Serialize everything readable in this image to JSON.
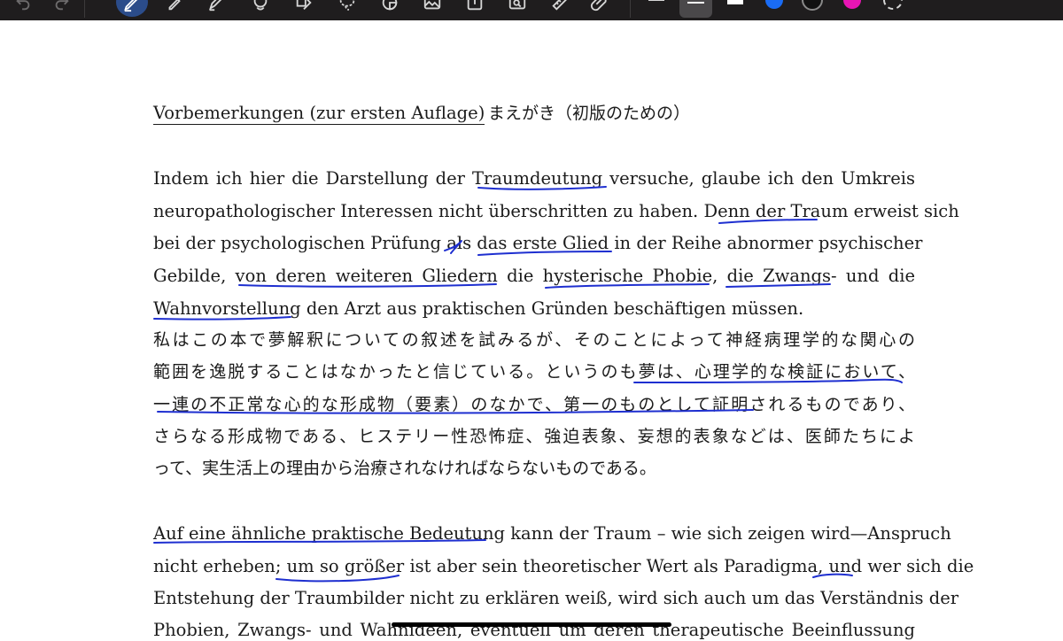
{
  "toolbar": {
    "tools": [
      "undo-icon",
      "redo-icon",
      "pen-icon",
      "highlighter-icon",
      "marker-icon",
      "lasso-fill-icon",
      "shape-icon",
      "lasso-select-icon",
      "sticker-icon",
      "image-icon",
      "export-icon",
      "image-search-icon",
      "ruler-icon",
      "attachment-icon"
    ],
    "colors": {
      "blue": "#1a6cf5",
      "black": "#111111",
      "magenta": "#e815b4",
      "active_pen": "#2b4c8a"
    }
  },
  "document": {
    "heading_de": "Vorbemerkungen (zur ersten Auflage)",
    "heading_ja": "まえがき（初版のための）",
    "p1": [
      "Indem ich hier die Darstellung der Traumdeutung versuche, glaube ich den Umkreis",
      "neuropathologischer Interessen nicht überschritten zu haben. Denn der Traum erweist sich",
      "bei der psychologischen Prüfung als das erste Glied in der Reihe abnormer psychischer",
      "Gebilde, von deren weiteren Gliedern die hysterische Phobie, die Zwangs- und die",
      "Wahnvorstellung den Arzt aus praktischen Gründen beschäftigen müssen."
    ],
    "p1_ja": [
      "私はこの本で夢解釈についての叙述を試みるが、そのことによって神経病理学的な関心の",
      "範囲を逸脱することはなかったと信じている。というのも夢は、心理学的な検証において、",
      "一連の不正常な心的な形成物（要素）のなかで、第一のものとして証明されるものであり、",
      "さらなる形成物である、ヒステリー性恐怖症、強迫表象、妄想的表象などは、医師たちによ",
      "って、実生活上の理由から治療されなければならないものである。"
    ],
    "p2": [
      "Auf eine ähnliche praktische Bedeutung kann der Traum – wie sich zeigen wird—Anspruch",
      "nicht erheben; um so größer ist aber sein theoretischer Wert als Paradigma, und wer sich die",
      "Entstehung der Traumbilder nicht zu erklären weiß, wird sich auch um das Verständnis der",
      "Phobien, Zwangs- und Wahnideen, eventuell um deren therapeutische Beeinflussung"
    ]
  }
}
